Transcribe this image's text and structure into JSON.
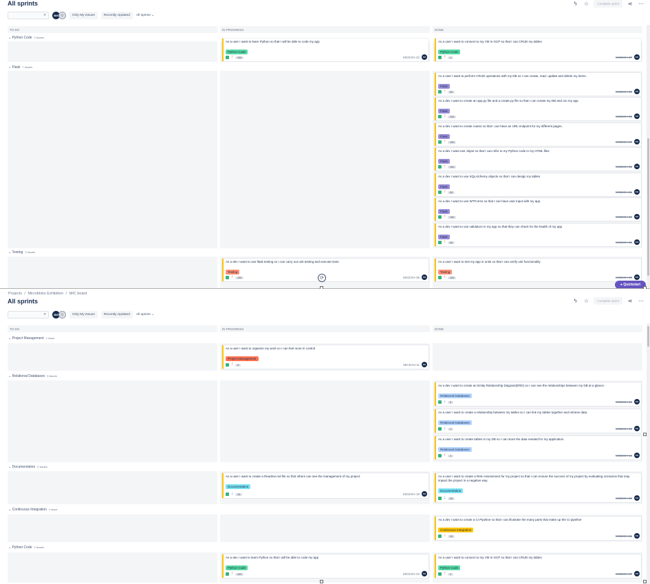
{
  "top": {
    "title": "All sprints",
    "complete_sprint": "Complete sprint",
    "search_placeholder": "",
    "avatar_initials": "BM",
    "filters": [
      "Only My Issues",
      "Recently Updated"
    ],
    "sprint_dropdown": "All sprints ⌄",
    "columns": [
      "TO DO",
      "IN PROGRESS",
      "DONE"
    ],
    "swimlanes": [
      {
        "name": "Python Code",
        "count": "2 issues"
      },
      {
        "name": "Flask",
        "count": "7 issues"
      },
      {
        "name": "Testing",
        "count": "2 issues"
      }
    ],
    "cards": [
      {
        "title": "As a user I want to learn Python so that I will be able to code my app",
        "label": "Python Code",
        "points": "100",
        "key": "MICEXH-22",
        "avatar": "BM"
      },
      {
        "title": "As a user I want to connect to my VM in GCP so that I can CRUD my tables",
        "label": "Python Code",
        "points": "1",
        "key": "MICEXH-27",
        "avatar": "BM"
      },
      {
        "title": "As a user I want to perform CRUD operations with my DB so I can create, read, update and delete my items.",
        "label": "Flask",
        "points": "50",
        "key": "MICEXH-30",
        "avatar": "BM"
      },
      {
        "title": "As a dev I want to create an app.py file and a create.py file so that I can create my DB and run my app",
        "label": "Flask",
        "points": "100",
        "key": "MICEXH-28",
        "avatar": "BM"
      },
      {
        "title": "As a dev I want to create routes so that I can have an URL endpoint for my different pages.",
        "label": "Flask",
        "points": "100",
        "key": "MICEXH-29",
        "avatar": "BM"
      },
      {
        "title": "As a dev I want use Jinja2 so that I can refer to my Python code in my HTML files",
        "label": "Flask",
        "points": "100",
        "key": "MICEXH-33",
        "avatar": "BM"
      },
      {
        "title": "As a dev I want to use SQLAlchemy objects so that I can design my tables",
        "label": "Flask",
        "points": "50",
        "key": "MICEXH-31",
        "avatar": "BM"
      },
      {
        "title": "As a dev I want to use WTForms so that I can have user input with my app",
        "label": "Flask",
        "points": "100",
        "key": "MICEXH-34",
        "avatar": "BM"
      },
      {
        "title": "As a dev I want to use validators in my app so that they can check for the health of my app",
        "label": "Flask",
        "points": "50",
        "key": "MICEXH-35",
        "avatar": "BM"
      },
      {
        "title": "As a dev I want to use flask testing so I can carry out unit testing and execute tests",
        "label": "Testing",
        "points": "100",
        "key": "MICEXH-38",
        "avatar": "BM"
      },
      {
        "title": "As a user I want to test my app in units so that I can verify unit functionality",
        "label": "Testing",
        "points": "100",
        "key": "MICEXH-36",
        "avatar": "BM"
      }
    ],
    "quickstart": "Quickstart"
  },
  "bottom": {
    "breadcrumb": [
      "Projects",
      "/",
      "Microbloks Exhibition",
      "/",
      "MIC board"
    ],
    "title": "All sprints",
    "complete_sprint": "Complete sprint",
    "avatar_initials": "BM",
    "filters": [
      "Only My Issues",
      "Recently Updated"
    ],
    "sprint_dropdown": "All sprints ⌄",
    "columns": [
      "TO DO",
      "IN PROGRESS",
      "DONE"
    ],
    "swimlanes": [
      {
        "name": "Project Management",
        "count": "1 issue"
      },
      {
        "name": "Relational Databases",
        "count": "3 issues"
      },
      {
        "name": "Documentation",
        "count": "2 issues"
      },
      {
        "name": "Continuous Integration",
        "count": "1 issue"
      },
      {
        "name": "Python Code",
        "count": "2 issues"
      }
    ],
    "cards": [
      {
        "title": "As a user I want to organize my work so I can feel more in control",
        "label": "Project Management",
        "points": "5",
        "key": "MICEXH-11",
        "avatar": "BM"
      },
      {
        "title": "As a dev I want to create an Entity Relationship Diagram(ERD) so I can see the relationships between my DB at a glance.",
        "label": "Relational Databases",
        "points": "5",
        "key": "MICEXH-18",
        "avatar": "BM"
      },
      {
        "title": "As a user I want to create a relationship between my tables so I can link my tables together and retrieve data.",
        "label": "Relational Databases",
        "points": "1",
        "key": "MICEXH-15",
        "avatar": "BM"
      },
      {
        "title": "As a user I want to create tables in my DB so I can store the data needed for my application",
        "label": "Relational Databases",
        "points": "2",
        "key": "MICEXH-14",
        "avatar": "BM"
      },
      {
        "title": "As a user I want to create a Readme.md file so that others can see the management of my project.",
        "label": "Documentation",
        "points": "10",
        "key": "MICEXH-19",
        "avatar": "BM"
      },
      {
        "title": "As a user I want to create a Risk Assessment for my project so that I can ensure the success of my project by evaluating scenarios that may impact the project in a negative way.",
        "label": "Documentation",
        "points": "30",
        "key": "MICEXH-20",
        "avatar": "BM"
      },
      {
        "title": "As a dev I want to create a CI Pipeline so that I can illustrate the many parts that make up the CI pipeline",
        "label": "Continuous Integration",
        "points": "20",
        "key": "MICEXH-21",
        "avatar": "BM"
      },
      {
        "title": "As a dev I want to learn Python so that I will be able to code my app",
        "label": "Python Code",
        "points": "100",
        "key": "MICEXH-22",
        "avatar": "BM"
      },
      {
        "title": "As a user I want to connect to my VM in GCP so that I can CRUD my tables",
        "label": "Python Code",
        "points": "1",
        "key": "MICEXH-27",
        "avatar": "BM"
      }
    ]
  },
  "colors": {
    "story": "#36b37e",
    "priority_high": "#de350b",
    "priority_low": "#0065ff",
    "epic_border": "#ffc400",
    "label_python": "#57d9a3",
    "label_flask": "#998dd9",
    "label_testing": "#ff8f73",
    "label_pm": "#ff7452",
    "label_rdb": "#b3d4ff",
    "label_doc": "#79e2f2",
    "label_ci": "#ffc400"
  }
}
